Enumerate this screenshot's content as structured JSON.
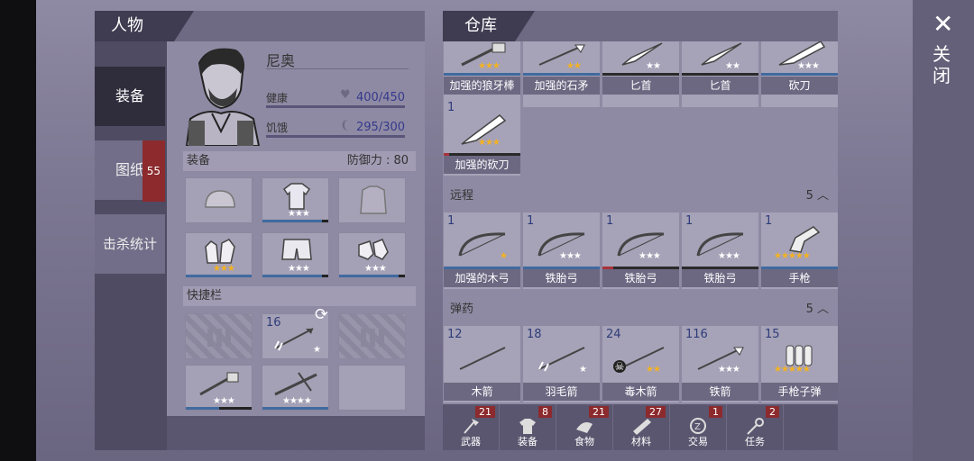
{
  "character": {
    "header": "人物",
    "tabs": [
      {
        "label": "装备",
        "active": true
      },
      {
        "label": "图纸",
        "badge": "55"
      },
      {
        "label": "击杀统计"
      }
    ],
    "name": "尼奥",
    "health_label": "健康",
    "health_value": "400/450",
    "hunger_label": "饥饿",
    "hunger_value": "295/300",
    "equipment_title": "装备",
    "defense_label": "防御力 : 80",
    "quickbar_title": "快捷栏",
    "quick_arrow_qty": "16"
  },
  "storage": {
    "header": "仓库",
    "top_row": [
      {
        "label": "加强的狼牙棒",
        "stars": "★★★",
        "gold": true
      },
      {
        "label": "加强的石矛",
        "stars": "★★",
        "gold": true
      },
      {
        "label": "匕首",
        "stars": "★★",
        "gold": false
      },
      {
        "label": "匕首",
        "stars": "★★",
        "gold": false
      },
      {
        "label": "砍刀",
        "stars": "★★★",
        "gold": false
      }
    ],
    "machete_plus": {
      "qty": "1",
      "label": "加强的砍刀",
      "stars": "★★★"
    },
    "ranged": {
      "title": "远程",
      "count": "5",
      "items": [
        {
          "qty": "1",
          "label": "加强的木弓",
          "stars": "★",
          "gold": true
        },
        {
          "qty": "1",
          "label": "铁胎弓",
          "stars": "★★★",
          "gold": false
        },
        {
          "qty": "1",
          "label": "铁胎弓",
          "stars": "★★★",
          "gold": false
        },
        {
          "qty": "1",
          "label": "铁胎弓",
          "stars": "★★★",
          "gold": false
        },
        {
          "qty": "1",
          "label": "手枪",
          "stars": "★★★★★",
          "gold": true
        }
      ]
    },
    "ammo": {
      "title": "弹药",
      "count": "5",
      "items": [
        {
          "qty": "12",
          "label": "木箭",
          "stars": "",
          "gold": false
        },
        {
          "qty": "18",
          "label": "羽毛箭",
          "stars": "★",
          "gold": false
        },
        {
          "qty": "24",
          "label": "毒木箭",
          "stars": "★★",
          "gold": true
        },
        {
          "qty": "116",
          "label": "铁箭",
          "stars": "★★★",
          "gold": false
        },
        {
          "qty": "15",
          "label": "手枪子弹",
          "stars": "★★★★★",
          "gold": true
        }
      ]
    },
    "bottom_tabs": [
      {
        "label": "武器",
        "count": "21"
      },
      {
        "label": "装备",
        "count": "8"
      },
      {
        "label": "食物",
        "count": "21"
      },
      {
        "label": "材料",
        "count": "27"
      },
      {
        "label": "交易",
        "count": "1"
      },
      {
        "label": "任务",
        "count": "2"
      }
    ]
  },
  "close": {
    "icon": "✕",
    "label": "关闭"
  }
}
